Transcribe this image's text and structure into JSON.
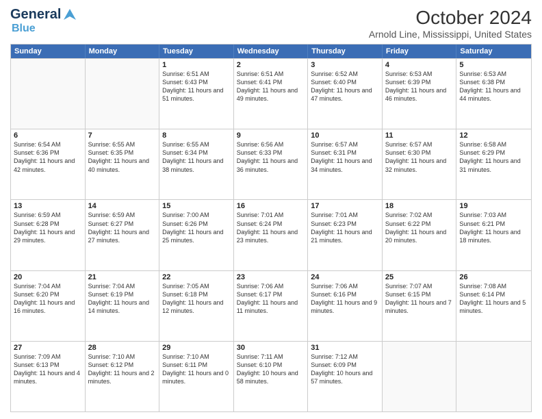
{
  "logo": {
    "general": "General",
    "blue": "Blue"
  },
  "title": "October 2024",
  "subtitle": "Arnold Line, Mississippi, United States",
  "header_days": [
    "Sunday",
    "Monday",
    "Tuesday",
    "Wednesday",
    "Thursday",
    "Friday",
    "Saturday"
  ],
  "weeks": [
    [
      {
        "day": "",
        "empty": true
      },
      {
        "day": "",
        "empty": true
      },
      {
        "day": "1",
        "sunrise": "Sunrise: 6:51 AM",
        "sunset": "Sunset: 6:43 PM",
        "daylight": "Daylight: 11 hours and 51 minutes."
      },
      {
        "day": "2",
        "sunrise": "Sunrise: 6:51 AM",
        "sunset": "Sunset: 6:41 PM",
        "daylight": "Daylight: 11 hours and 49 minutes."
      },
      {
        "day": "3",
        "sunrise": "Sunrise: 6:52 AM",
        "sunset": "Sunset: 6:40 PM",
        "daylight": "Daylight: 11 hours and 47 minutes."
      },
      {
        "day": "4",
        "sunrise": "Sunrise: 6:53 AM",
        "sunset": "Sunset: 6:39 PM",
        "daylight": "Daylight: 11 hours and 46 minutes."
      },
      {
        "day": "5",
        "sunrise": "Sunrise: 6:53 AM",
        "sunset": "Sunset: 6:38 PM",
        "daylight": "Daylight: 11 hours and 44 minutes."
      }
    ],
    [
      {
        "day": "6",
        "sunrise": "Sunrise: 6:54 AM",
        "sunset": "Sunset: 6:36 PM",
        "daylight": "Daylight: 11 hours and 42 minutes."
      },
      {
        "day": "7",
        "sunrise": "Sunrise: 6:55 AM",
        "sunset": "Sunset: 6:35 PM",
        "daylight": "Daylight: 11 hours and 40 minutes."
      },
      {
        "day": "8",
        "sunrise": "Sunrise: 6:55 AM",
        "sunset": "Sunset: 6:34 PM",
        "daylight": "Daylight: 11 hours and 38 minutes."
      },
      {
        "day": "9",
        "sunrise": "Sunrise: 6:56 AM",
        "sunset": "Sunset: 6:33 PM",
        "daylight": "Daylight: 11 hours and 36 minutes."
      },
      {
        "day": "10",
        "sunrise": "Sunrise: 6:57 AM",
        "sunset": "Sunset: 6:31 PM",
        "daylight": "Daylight: 11 hours and 34 minutes."
      },
      {
        "day": "11",
        "sunrise": "Sunrise: 6:57 AM",
        "sunset": "Sunset: 6:30 PM",
        "daylight": "Daylight: 11 hours and 32 minutes."
      },
      {
        "day": "12",
        "sunrise": "Sunrise: 6:58 AM",
        "sunset": "Sunset: 6:29 PM",
        "daylight": "Daylight: 11 hours and 31 minutes."
      }
    ],
    [
      {
        "day": "13",
        "sunrise": "Sunrise: 6:59 AM",
        "sunset": "Sunset: 6:28 PM",
        "daylight": "Daylight: 11 hours and 29 minutes."
      },
      {
        "day": "14",
        "sunrise": "Sunrise: 6:59 AM",
        "sunset": "Sunset: 6:27 PM",
        "daylight": "Daylight: 11 hours and 27 minutes."
      },
      {
        "day": "15",
        "sunrise": "Sunrise: 7:00 AM",
        "sunset": "Sunset: 6:26 PM",
        "daylight": "Daylight: 11 hours and 25 minutes."
      },
      {
        "day": "16",
        "sunrise": "Sunrise: 7:01 AM",
        "sunset": "Sunset: 6:24 PM",
        "daylight": "Daylight: 11 hours and 23 minutes."
      },
      {
        "day": "17",
        "sunrise": "Sunrise: 7:01 AM",
        "sunset": "Sunset: 6:23 PM",
        "daylight": "Daylight: 11 hours and 21 minutes."
      },
      {
        "day": "18",
        "sunrise": "Sunrise: 7:02 AM",
        "sunset": "Sunset: 6:22 PM",
        "daylight": "Daylight: 11 hours and 20 minutes."
      },
      {
        "day": "19",
        "sunrise": "Sunrise: 7:03 AM",
        "sunset": "Sunset: 6:21 PM",
        "daylight": "Daylight: 11 hours and 18 minutes."
      }
    ],
    [
      {
        "day": "20",
        "sunrise": "Sunrise: 7:04 AM",
        "sunset": "Sunset: 6:20 PM",
        "daylight": "Daylight: 11 hours and 16 minutes."
      },
      {
        "day": "21",
        "sunrise": "Sunrise: 7:04 AM",
        "sunset": "Sunset: 6:19 PM",
        "daylight": "Daylight: 11 hours and 14 minutes."
      },
      {
        "day": "22",
        "sunrise": "Sunrise: 7:05 AM",
        "sunset": "Sunset: 6:18 PM",
        "daylight": "Daylight: 11 hours and 12 minutes."
      },
      {
        "day": "23",
        "sunrise": "Sunrise: 7:06 AM",
        "sunset": "Sunset: 6:17 PM",
        "daylight": "Daylight: 11 hours and 11 minutes."
      },
      {
        "day": "24",
        "sunrise": "Sunrise: 7:06 AM",
        "sunset": "Sunset: 6:16 PM",
        "daylight": "Daylight: 11 hours and 9 minutes."
      },
      {
        "day": "25",
        "sunrise": "Sunrise: 7:07 AM",
        "sunset": "Sunset: 6:15 PM",
        "daylight": "Daylight: 11 hours and 7 minutes."
      },
      {
        "day": "26",
        "sunrise": "Sunrise: 7:08 AM",
        "sunset": "Sunset: 6:14 PM",
        "daylight": "Daylight: 11 hours and 5 minutes."
      }
    ],
    [
      {
        "day": "27",
        "sunrise": "Sunrise: 7:09 AM",
        "sunset": "Sunset: 6:13 PM",
        "daylight": "Daylight: 11 hours and 4 minutes."
      },
      {
        "day": "28",
        "sunrise": "Sunrise: 7:10 AM",
        "sunset": "Sunset: 6:12 PM",
        "daylight": "Daylight: 11 hours and 2 minutes."
      },
      {
        "day": "29",
        "sunrise": "Sunrise: 7:10 AM",
        "sunset": "Sunset: 6:11 PM",
        "daylight": "Daylight: 11 hours and 0 minutes."
      },
      {
        "day": "30",
        "sunrise": "Sunrise: 7:11 AM",
        "sunset": "Sunset: 6:10 PM",
        "daylight": "Daylight: 10 hours and 58 minutes."
      },
      {
        "day": "31",
        "sunrise": "Sunrise: 7:12 AM",
        "sunset": "Sunset: 6:09 PM",
        "daylight": "Daylight: 10 hours and 57 minutes."
      },
      {
        "day": "",
        "empty": true
      },
      {
        "day": "",
        "empty": true
      }
    ]
  ]
}
